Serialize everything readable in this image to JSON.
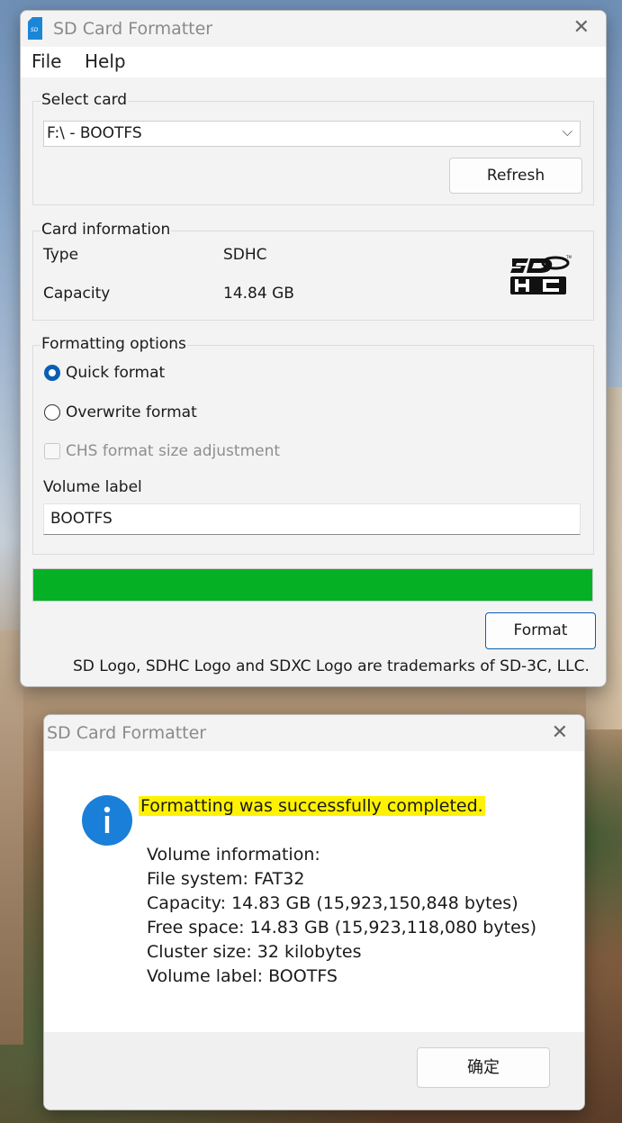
{
  "main_window": {
    "title": "SD Card Formatter",
    "menu": [
      "File",
      "Help"
    ],
    "select_card": {
      "group_title": "Select card",
      "selected": "F:\\ - BOOTFS",
      "refresh_label": "Refresh"
    },
    "card_info": {
      "group_title": "Card information",
      "type_label": "Type",
      "type_value": "SDHC",
      "capacity_label": "Capacity",
      "capacity_value": "14.84 GB",
      "logo_icon": "sdhc-logo-icon"
    },
    "formatting_options": {
      "group_title": "Formatting options",
      "quick_format": "Quick format",
      "quick_format_selected": true,
      "overwrite_format": "Overwrite format",
      "overwrite_format_selected": false,
      "chs_label": "CHS format size adjustment",
      "chs_checked": false,
      "chs_enabled": false,
      "volume_label_title": "Volume label",
      "volume_label_value": "BOOTFS"
    },
    "progress": {
      "value": 1.0,
      "color": "#06b025"
    },
    "format_label": "Format",
    "footer": "SD Logo, SDHC Logo and SDXC Logo are trademarks of SD-3C, LLC."
  },
  "dialog": {
    "title": "SD Card Formatter",
    "icon": "info-icon",
    "headline": "Formatting was successfully completed.",
    "lines": [
      "Volume information:",
      "File system: FAT32",
      "Capacity: 14.83 GB (15,923,150,848 bytes)",
      "Free space: 14.83 GB (15,923,118,080 bytes)",
      "Cluster size: 32 kilobytes",
      "Volume label: BOOTFS"
    ],
    "ok_label": "确定",
    "highlight_color": "#fff200"
  },
  "colors": {
    "accent": "#0a5fb4",
    "progress": "#06b025",
    "info_icon": "#1a7fd8"
  }
}
